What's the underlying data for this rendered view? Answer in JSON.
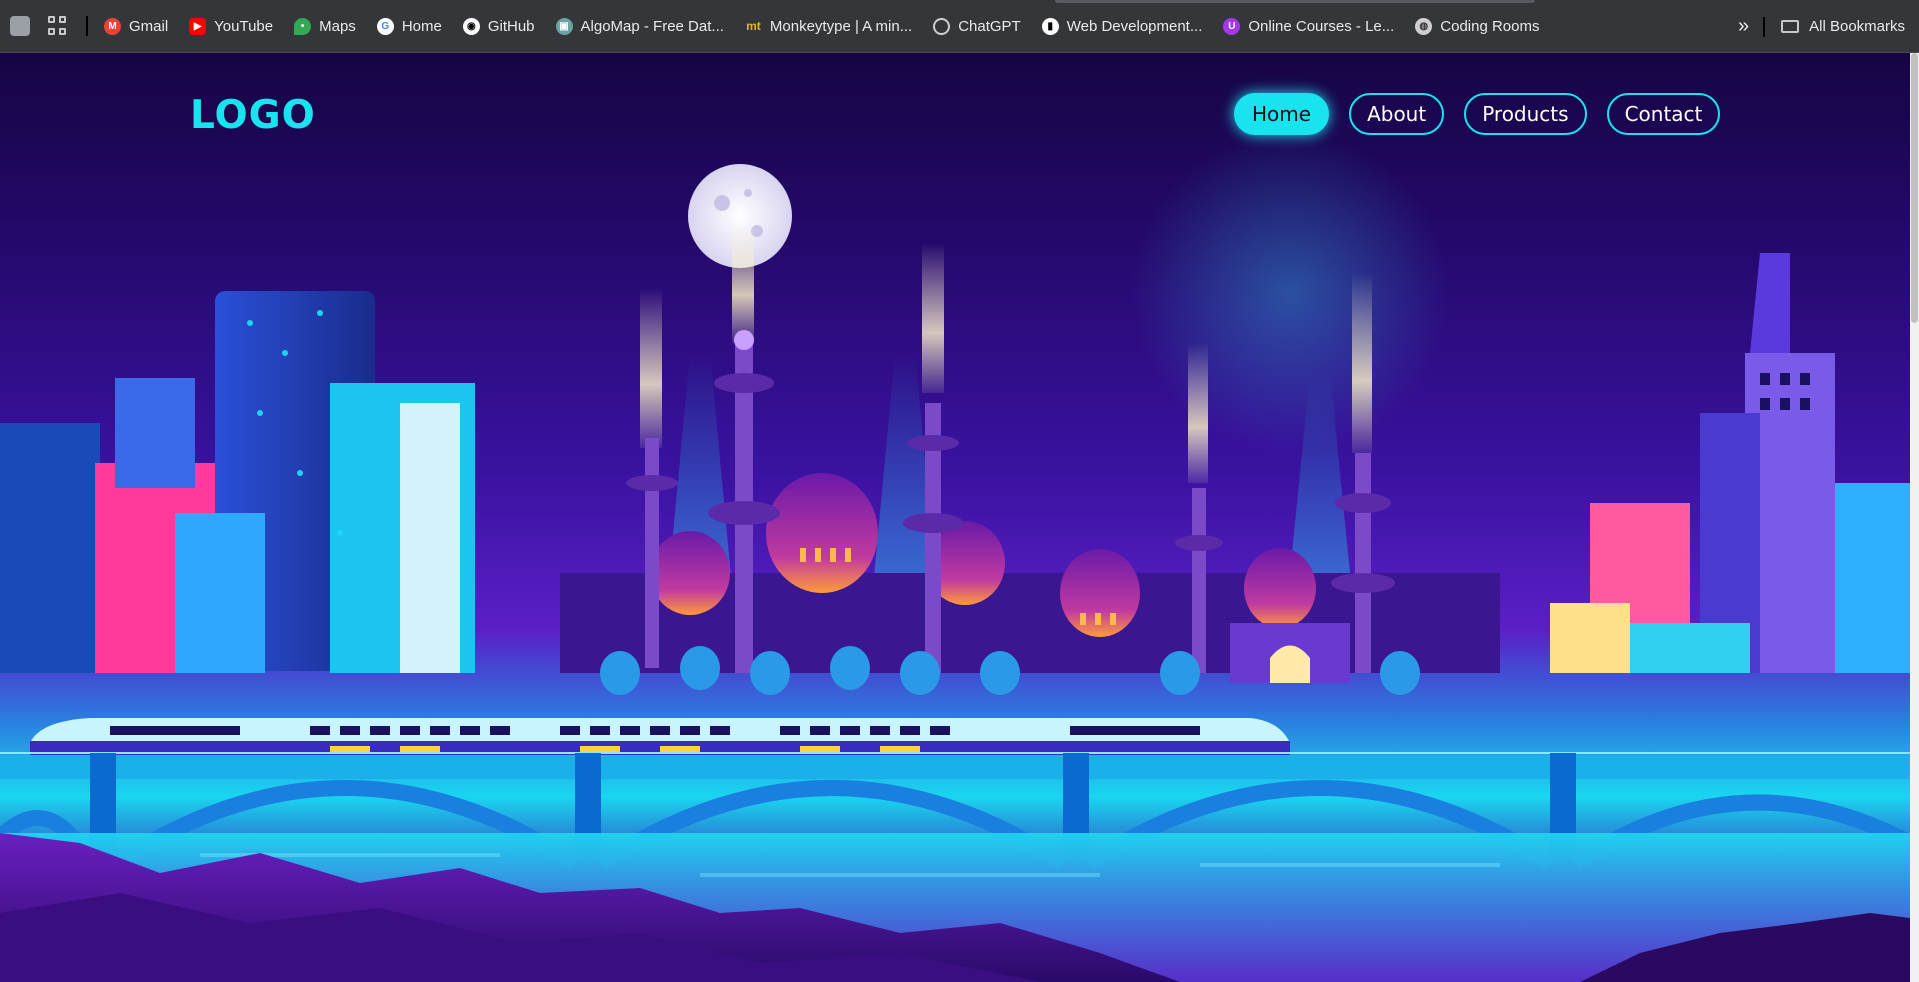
{
  "bookmarks": {
    "items": [
      {
        "label": "Gmail",
        "icon": "gmail-icon",
        "color": "#ea4335"
      },
      {
        "label": "YouTube",
        "icon": "youtube-icon",
        "color": "#ff0000"
      },
      {
        "label": "Maps",
        "icon": "maps-icon",
        "color": "#34a853"
      },
      {
        "label": "Home",
        "icon": "google-icon",
        "color": "#4285f4"
      },
      {
        "label": "GitHub",
        "icon": "github-icon",
        "color": "#ffffff"
      },
      {
        "label": "AlgoMap - Free Dat...",
        "icon": "algomap-icon",
        "color": "#6aa3a0"
      },
      {
        "label": "Monkeytype | A min...",
        "icon": "monkeytype-icon",
        "color": "#e2b714"
      },
      {
        "label": "ChatGPT",
        "icon": "chatgpt-icon",
        "color": "#cfcfcf"
      },
      {
        "label": "Web Development...",
        "icon": "webdev-icon",
        "color": "#f5c400"
      },
      {
        "label": "Online Courses - Le...",
        "icon": "udemy-icon",
        "color": "#a435f0"
      },
      {
        "label": "Coding Rooms",
        "icon": "globe-icon",
        "color": "#cfcfcf"
      }
    ],
    "more": "»",
    "all_bookmarks": "All Bookmarks"
  },
  "site": {
    "logo": "LOGO",
    "nav": [
      {
        "label": "Home",
        "active": true
      },
      {
        "label": "About",
        "active": false
      },
      {
        "label": "Products",
        "active": false
      },
      {
        "label": "Contact",
        "active": false
      }
    ],
    "accent": "#19e3ee"
  }
}
